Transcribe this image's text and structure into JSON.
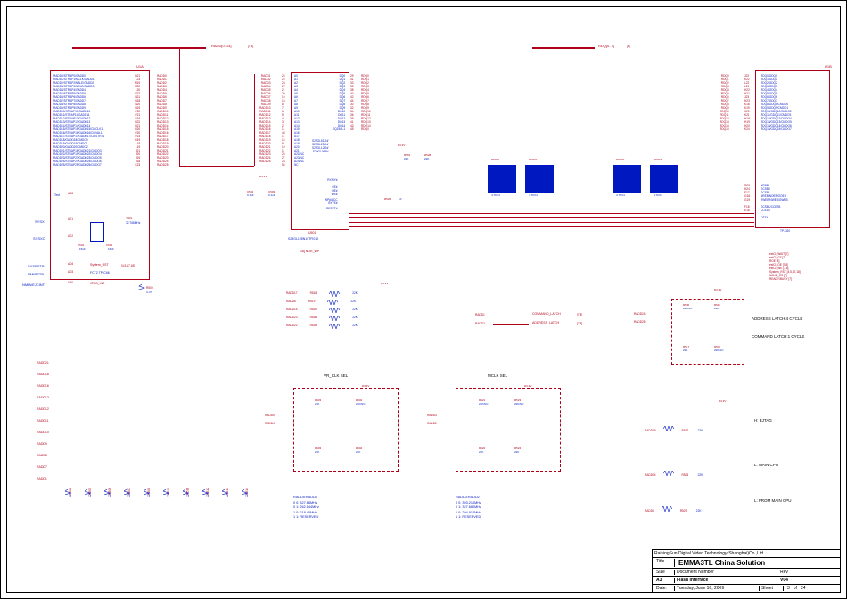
{
  "titleblock": {
    "company": "RaisingSun Digital Video Technology(Shanghai)Co.,Ltd.",
    "title_lbl": "Title",
    "title": "EMMA3TL China Solution",
    "subtitle": "Flash Interface",
    "size_lbl": "Size",
    "size": "A3",
    "docnum_lbl": "Document Number",
    "date_lbl": "Date:",
    "date": "Tuesday, June 16, 2009",
    "sheet_lbl": "Sheet",
    "sheet_a": "3",
    "sheet_of": "of",
    "sheet_b": "24",
    "rev_lbl": "Rev",
    "rev": "V04"
  },
  "buses": {
    "radd": "RADD[0..14]",
    "radd_ref": "[7,8]",
    "rdq": "RDQ[0..7]",
    "rdq_ref": "[8]"
  },
  "u1a": {
    "ref": "U1A",
    "pins_left": [
      "RADD0/STRAP0/GADD0",
      "RADD1/STRAP1/MCLK/GADD1",
      "RADD2/STRAP2/NALE/GADD2",
      "RADD3/STRAP3/NCLE/GADD3",
      "RADD4/STRAP4/GADD4",
      "RADD5/STRAP5/GADD5",
      "RADD6/STRAP6/GADD6",
      "RADD7/STRAP7/GADD7",
      "RADD8/STRAP8/GADD8",
      "RADD9/STRAP9/GADD9",
      "RADD10/STRAP10/GADD10",
      "RADD11/STRAP11/GADD11",
      "RADD12/STRAP12/GADD12",
      "RADD13/STRAP13/GADD13",
      "RADD14/STRAP14/GADD14",
      "RADD15/STRAP15/GADD15/CMCLK1",
      "RADD16/STRAP16/GADD16/CMVAL1",
      "RADD17/STRAP17/GADD17/CMSTRT1",
      "RADD18/GADD18/CMDO0",
      "RADD19/GADD19/CMDO1",
      "RADD20/GADD20/CMDO2",
      "RADD21/STRAP18/GADD21/CMDO3",
      "RADD22/STRAP19/GADD22/CMDO4",
      "RADD23/STRAP23/GADD23/CMDO5",
      "RADD24/STRAP24/GADD24/CMDO6",
      "RADD25/STRAP25/GADD25/CMDO7"
    ],
    "pins_left_no": [
      "D21",
      "L23",
      "M19",
      "M22",
      "L20",
      "N22",
      "N21",
      "N18",
      "N20",
      "N19",
      "P22",
      "P21",
      "P19",
      "R22",
      "R21",
      "R20",
      "P20",
      "P23",
      "R19",
      "L18",
      "L19",
      "J21",
      "J20",
      "J19",
      "J18",
      "K23"
    ],
    "test": "Test",
    "test_pin": "AC6",
    "sysxi": "SYSXI",
    "sysxi_pin": "AE1",
    "sysxo": "SYSXO",
    "sysxo_pin": "AE2",
    "sysrstb": "SYSRSTB",
    "sysrstb_pin": "AD4",
    "sysrstb_sig": "System_RST",
    "sysrstb_sig_ref": "[4,5,17,18]",
    "nmirstrb": "NMIRSTB",
    "nmirstrb_pin": "AD3",
    "nmirstrb_tp": "FCT2  TP-C66",
    "ejcint": "NMIA/EJCINT",
    "ejcint_pin": "U20",
    "ejcint_sig": "JTAG_INT"
  },
  "cryst": {
    "ref": "Y501",
    "val": "32.768MHz",
    "c1": "C501",
    "c1v": "15pF",
    "c2": "C502",
    "c2v": "15pF"
  },
  "r509": {
    "ref": "R509",
    "val": "4.7K"
  },
  "u501": {
    "ref": "U501",
    "part": "S29GL128N10TFI010",
    "note": "[18]  NOR_WP",
    "left_pins": [
      "A0",
      "A1",
      "A2",
      "A3",
      "A4",
      "A5",
      "A6",
      "A7",
      "A8",
      "A9",
      "A10",
      "A11",
      "A12",
      "A13",
      "A14",
      "A15",
      "A16",
      "A17",
      "A18",
      "A19",
      "A20",
      "A21",
      "A22/NC",
      "A23/NC",
      "A24/NC",
      "NC"
    ],
    "left_pin_no": [
      "25",
      "24",
      "23",
      "22",
      "21",
      "20",
      "19",
      "18",
      "8",
      "7",
      "6",
      "5",
      "4",
      "3",
      "2",
      "1",
      "48",
      "17",
      "16",
      "9",
      "10",
      "11",
      "26",
      "27",
      "28",
      "56"
    ],
    "left_pin_no2": [
      "13",
      "14"
    ],
    "right_pins": [
      "DQ0",
      "DQ1",
      "DQ2",
      "DQ3",
      "DQ4",
      "DQ5",
      "DQ6",
      "DQ7",
      "DQ8",
      "DQ9",
      "DQ10",
      "DQ11",
      "DQ12",
      "DQ13",
      "DQ14",
      "DQ15/A-1"
    ],
    "right_pin_no": [
      "29",
      "31",
      "33",
      "35",
      "38",
      "40",
      "42",
      "44",
      "30",
      "32",
      "34",
      "36",
      "39",
      "41",
      "43",
      "45"
    ],
    "ctrl": [
      "RY/BY#",
      "CE#",
      "OE#",
      "WE#",
      "WP#/ACC",
      "BYTE#",
      "RESET#",
      "VCC",
      "VSS",
      "VSS"
    ],
    "ctrl_no": [
      "15",
      "37",
      "46",
      "47",
      "12",
      "54",
      "55"
    ],
    "alt": [
      "S29GL512N/",
      "S29GL256N/",
      "S29GL128N/",
      "S29GL064N"
    ]
  },
  "caps": {
    "c503": "C503",
    "c503v": "0.1uF",
    "c504": "C504",
    "c504v": "0.1uF"
  },
  "rpull": {
    "r526": "R526",
    "r526v": "1K",
    "r501": "R501",
    "r501v": "22K",
    "r528": "R528",
    "r528v": "22K"
  },
  "rn": {
    "rn501": "RN501",
    "rn502": "RN502",
    "rn503": "RN503",
    "rn504": "RN504",
    "rnv": "4.7KX4"
  },
  "u1b": {
    "ref": "U1B",
    "right_labels": [
      "RDQ0/GDQ0",
      "RDQ1/GDQ1",
      "RDQ2/GDQ2",
      "RDQ3/GDQ3",
      "RDQ4/GDQ4",
      "RDQ5/GDQ5",
      "RDQ6/GDQ6",
      "RDQ7/GDQ7",
      "RDQ8/GDQ8/CMDO0",
      "RDQ9/GDQ9/CMDO1",
      "RDQ10/GDQ10/CMDO2",
      "RDQ11/GDQ11/CMDO3",
      "RDQ12/GDQ12/CMDO4",
      "RDQ13/GDQ13/CMDO5",
      "RDQ14/GDQ14/CMDO6",
      "RDQ15/GDQ15/CMDO7"
    ],
    "right_pin_no": [
      "J22",
      "K22",
      "L22",
      "L21",
      "H22",
      "H21",
      "J23",
      "H23",
      "K18",
      "K19",
      "K20",
      "K21",
      "H18",
      "H19",
      "H20",
      "K24"
    ],
    "ctrl": [
      "NRBB",
      "GCSB0",
      "GCSB1",
      "NREB/NOEB/GOEB",
      "RWEB/NWEB/GWEB",
      "GCSB1/CCE2B",
      "CCE1B",
      "FCT1"
    ],
    "ctrl_no": [
      "R23",
      "H24",
      "E17",
      "G18",
      "G19",
      "F18",
      "E18",
      "G20"
    ],
    "tp": "TP-C60",
    "nets": [
      "extCI_WAIT  [7]",
      "extCI_CS  [7]",
      "ROE  [8]",
      "extCI_OE  [7,8]",
      "extCI_WE  [7,8]",
      "System_RST  [4,5,17,18]",
      "NAND_CS  [7]",
      "READY/BUSY  [7]"
    ]
  },
  "straplist": {
    "left": [
      "RADD21",
      "RADD18",
      "RADD16",
      "RADD13",
      "RADD12",
      "RADD11",
      "RADD10",
      "RADD9",
      "RADD8",
      "RADD7",
      "RADD1"
    ],
    "bottom_r": [
      "R502",
      "R505",
      "R506",
      "R507",
      "R508",
      "R510",
      "R511",
      "R512",
      "R513",
      "R514"
    ],
    "bottom_val": "22K"
  },
  "mid_resrows": {
    "rows": [
      {
        "net": "RADD17",
        "r": "R518",
        "v": "22K"
      },
      {
        "net": "RADD6",
        "r": "R519",
        "v": "22K"
      },
      {
        "net": "RADD15",
        "r": "R520",
        "v": "22K"
      },
      {
        "net": "RADD23",
        "r": "R536",
        "v": "22K"
      },
      {
        "net": "RADD22",
        "r": "R535",
        "v": "22K"
      }
    ],
    "rail": "D3.3V"
  },
  "cmd_latch": {
    "a": "RADD1",
    "a_sig": "COMMAND_LATCH",
    "a_ref": "[7,8]",
    "b": "RADD2",
    "b_sig": "ADDRESS_LATCH",
    "b_ref": "[7,8]"
  },
  "addr_sel": {
    "net_a": "RADD24",
    "net_b": "RADD25",
    "r530": "R530",
    "r530v": "22K/NC",
    "r516": "R516",
    "r516v": "22K",
    "r517": "R517",
    "r517v": "22K",
    "r531": "R531",
    "r531v": "22K/NC",
    "rail": "D3.3V",
    "note_a": "ADDRESS LATCH:4 CYCLE",
    "note_b": "COMMAND LATCH:1 CYCLE"
  },
  "vrclk": {
    "title": "VR_CLK SEL",
    "rail": "D3.3V",
    "net_a": "RADD5",
    "net_b": "RADD4",
    "r533": "R533",
    "r533v": "22K",
    "r532": "R532",
    "r532v": "22K/NC",
    "r503": "R503",
    "r503v": "22K",
    "r504": "R504",
    "r504v": "22K",
    "hdr": "RADD5:RADD4",
    "rows": [
      "0  0:  327.68MHz",
      "0  1:  262.144MHz",
      "1  0:  218.45MHz",
      "1  1:  RESERVED"
    ]
  },
  "mclk": {
    "title": "MCLK SEL",
    "rail": "D3.3V",
    "net_a": "RADD3",
    "net_b": "RADD2",
    "r521": "R521",
    "r521v": "22K/NC",
    "r523": "R523",
    "r523v": "22K/NC",
    "r522": "R522",
    "r522v": "22K",
    "r524": "R524",
    "r524v": "22K",
    "hdr": "RADD3:RADD2",
    "rows": [
      "0  0:  393.216MHz",
      "0  1:  327.680MHz",
      "1  0:  294.912MHz",
      "1  1:  RESERVED"
    ]
  },
  "rightstrap": {
    "rail": "D3.3V",
    "rows": [
      {
        "net": "RADD19",
        "r": "R527",
        "v": "22K",
        "note": "H: EJTAG"
      },
      {
        "net": "RADD14",
        "r": "R525",
        "v": "22K",
        "note": "L: MAIN CPU"
      },
      {
        "net": "RADD0",
        "r": "R529",
        "v": "22K",
        "note": "L: FROM MAIN CPU"
      }
    ]
  }
}
